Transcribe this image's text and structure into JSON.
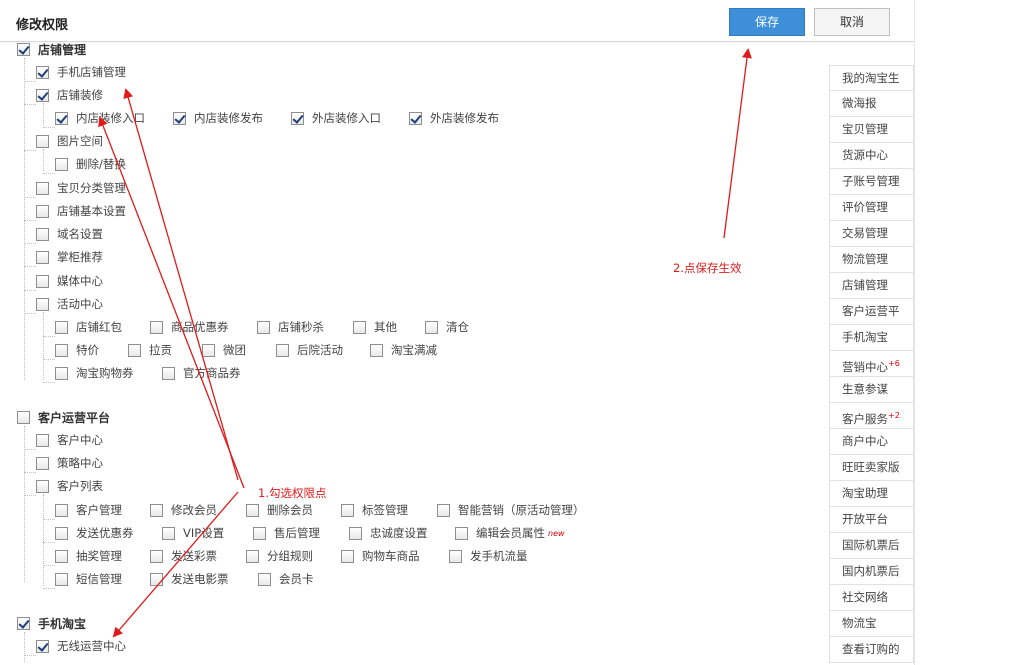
{
  "header": {
    "title": "修改权限",
    "save_label": "保存",
    "cancel_label": "取消"
  },
  "tree": {
    "store": "店铺管理",
    "mobile_store": "手机店铺管理",
    "decor": "店铺装修",
    "decor_in_entry": "内店装修入口",
    "decor_in_publish": "内店装修发布",
    "decor_out_entry": "外店装修入口",
    "decor_out_publish": "外店装修发布",
    "image_space": "图片空间",
    "image_delete": "删除/替换",
    "category": "宝贝分类管理",
    "basic": "店铺基本设置",
    "domain": "域名设置",
    "recommend": "掌柜推荐",
    "media": "媒体中心",
    "activity": "活动中心",
    "act_packet": "店铺红包",
    "act_coupon": "商品优惠券",
    "act_spike": "店铺秒杀",
    "act_other": "其他",
    "act_clear": "清仓",
    "act_special": "特价",
    "act_gift": "拉贡",
    "act_group": "微团",
    "act_after": "后院活动",
    "act_full": "淘宝满减",
    "act_shopping": "淘宝购物券",
    "act_official": "官方商品券",
    "crm": "客户运营平台",
    "crm_center": "客户中心",
    "crm_strategy": "策略中心",
    "crm_list": "客户列表",
    "cl_manage": "客户管理",
    "cl_edit": "修改会员",
    "cl_delete": "删除会员",
    "cl_tags": "标签管理",
    "cl_smart": "智能营销（原活动管理）",
    "cl_send_coupon": "发送优惠券",
    "cl_vip": "VIP设置",
    "cl_after_sale": "售后管理",
    "cl_loyalty": "忠诚度设置",
    "cl_edit_attr": "编辑会员属性",
    "cl_new": "new",
    "cl_lottery": "抽奖管理",
    "cl_send_lottery": "发送彩票",
    "cl_group_rule": "分组规则",
    "cl_cart": "购物车商品",
    "cl_sms_flow": "发手机流量",
    "cl_sms": "短信管理",
    "cl_movie": "发送电影票",
    "cl_card": "会员卡",
    "mobile_taobao": "手机淘宝",
    "wireless": "无线运营中心"
  },
  "checked": {
    "store": true,
    "mobile_store": true,
    "decor": true,
    "decor_in_entry": true,
    "decor_in_publish": true,
    "decor_out_entry": true,
    "decor_out_publish": true,
    "mobile_taobao": true,
    "wireless": true
  },
  "right_menu": [
    {
      "label": "我的淘宝生"
    },
    {
      "label": "微海报"
    },
    {
      "label": "宝贝管理"
    },
    {
      "label": "货源中心"
    },
    {
      "label": "子账号管理"
    },
    {
      "label": "评价管理"
    },
    {
      "label": "交易管理"
    },
    {
      "label": "物流管理"
    },
    {
      "label": "店铺管理"
    },
    {
      "label": "客户运营平"
    },
    {
      "label": "手机淘宝"
    },
    {
      "label": "营销中心",
      "badge": "+6"
    },
    {
      "label": "生意参谋"
    },
    {
      "label": "客户服务",
      "badge": "+2"
    },
    {
      "label": "商户中心"
    },
    {
      "label": "旺旺卖家版"
    },
    {
      "label": "淘宝助理"
    },
    {
      "label": "开放平台"
    },
    {
      "label": "国际机票后"
    },
    {
      "label": "国内机票后"
    },
    {
      "label": "社交网络"
    },
    {
      "label": "物流宝"
    },
    {
      "label": "查看订购的"
    }
  ],
  "annotations": {
    "step1": "1.勾选权限点",
    "step2": "2.点保存生效"
  },
  "colors": {
    "accent": "#3d8fd9",
    "annotation": "#e01b1b"
  }
}
